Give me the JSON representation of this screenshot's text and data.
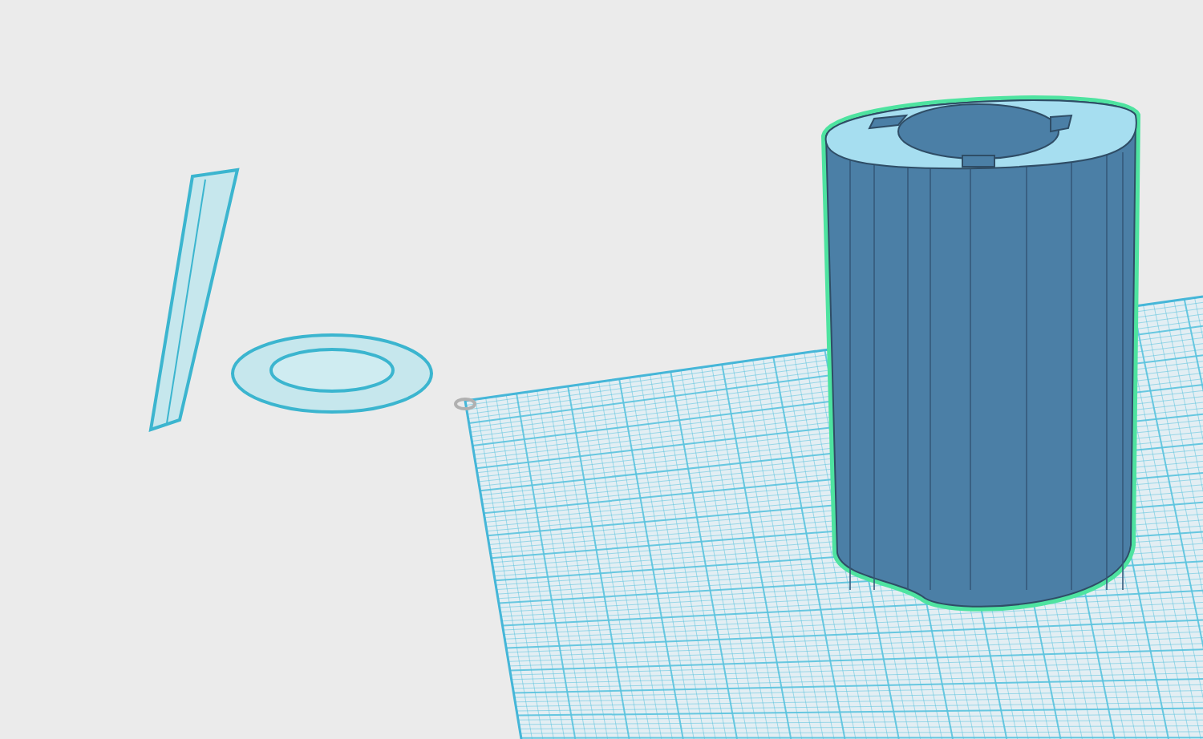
{
  "viewport": {
    "grid": {
      "visible": true
    }
  },
  "objects": [
    {
      "kind": "strip",
      "selected": false
    },
    {
      "kind": "ring",
      "selected": false
    },
    {
      "kind": "cylinder",
      "selected": true
    }
  ]
}
